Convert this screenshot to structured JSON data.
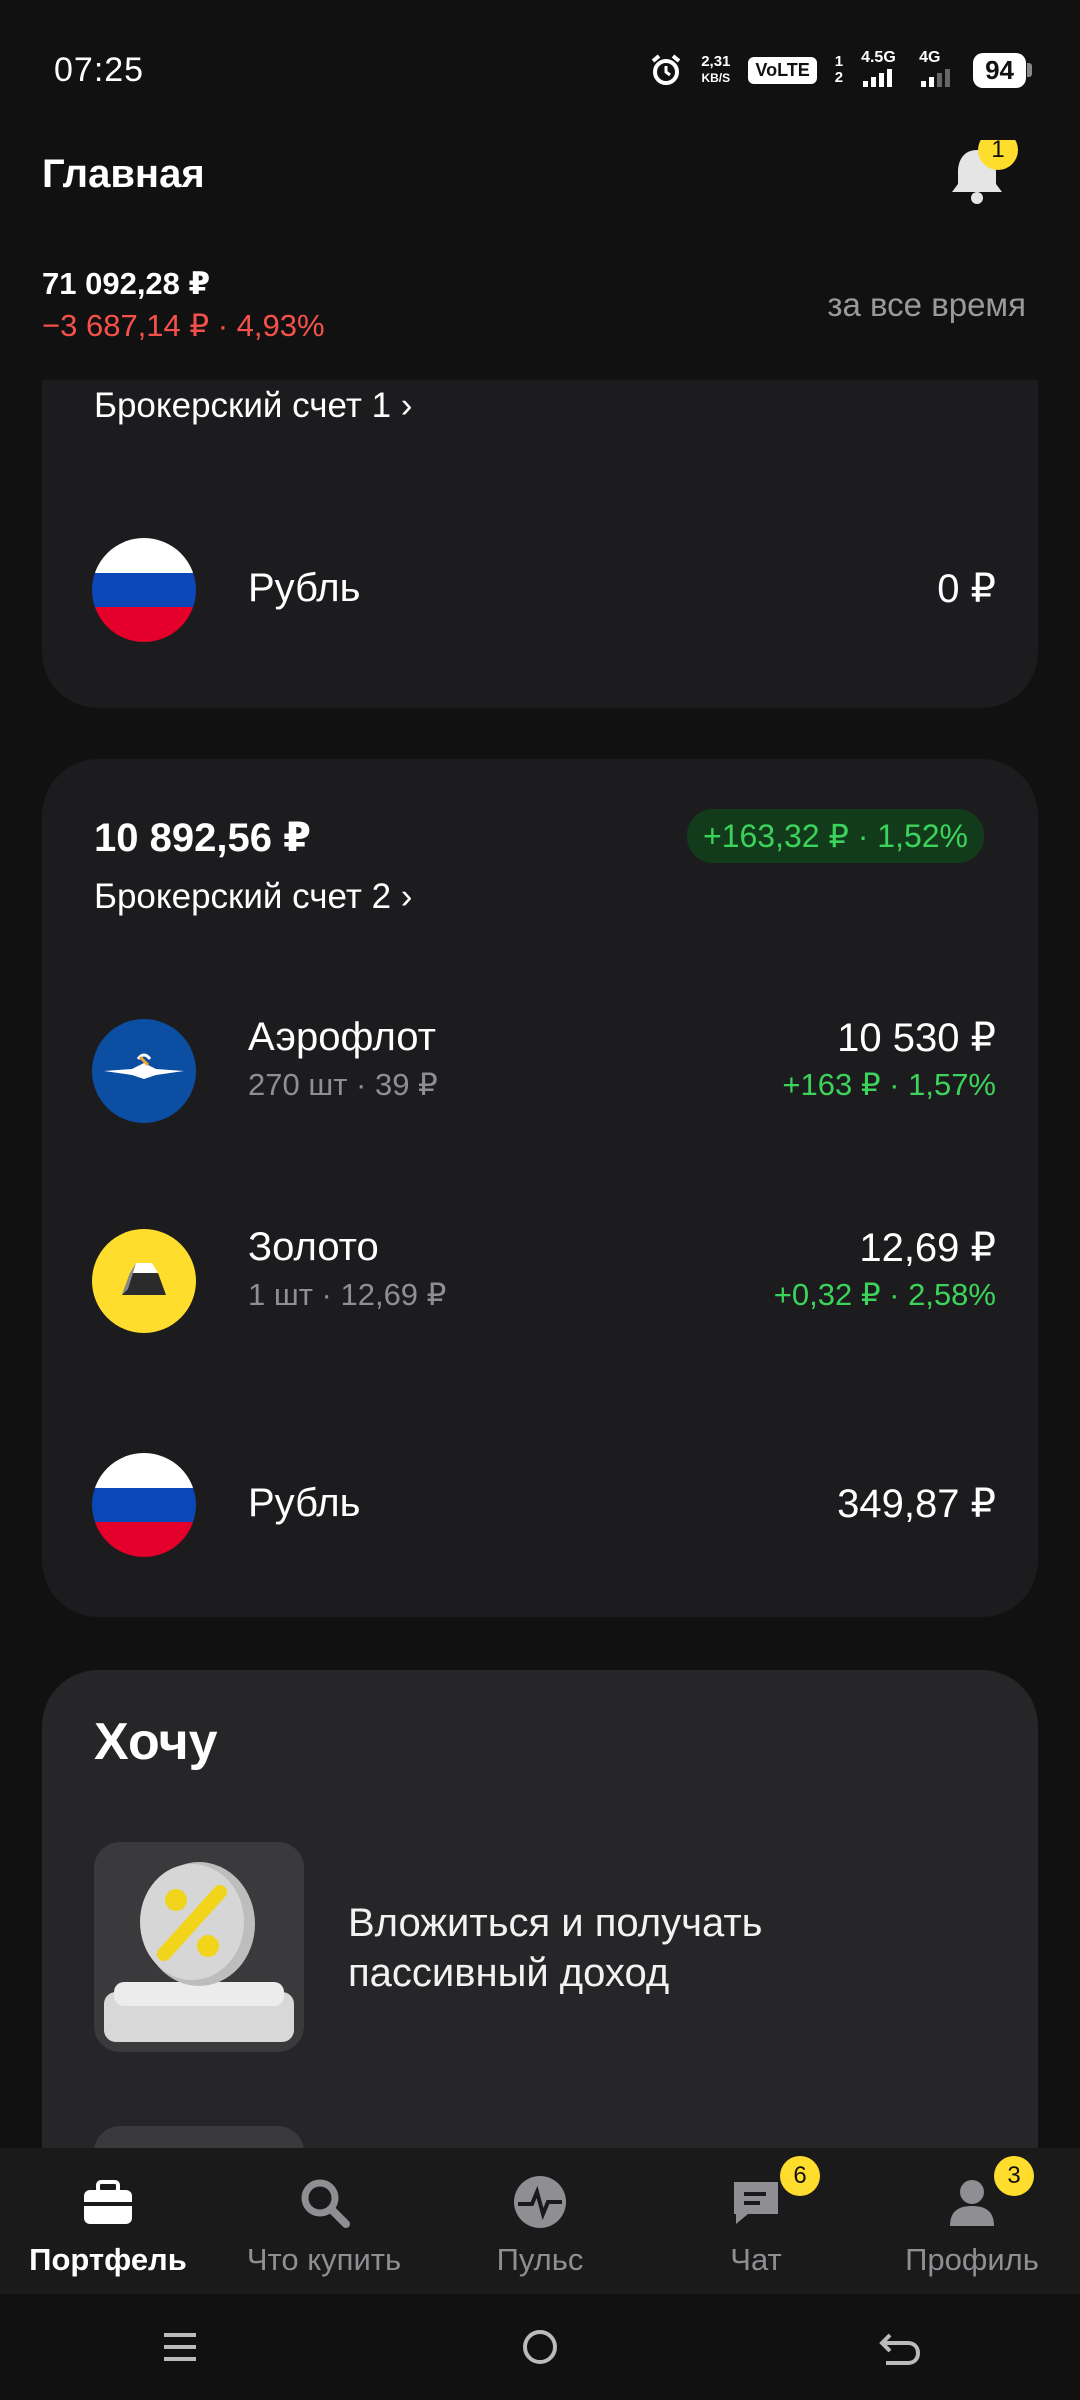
{
  "status_bar": {
    "time": "07:25",
    "net_speed_top": "2,31",
    "net_speed_bottom": "KB/S",
    "volte": "VoLTE",
    "sim1_top": "1",
    "sim1_bottom": "2",
    "net1": "4.5G",
    "net2": "4G",
    "battery": "94"
  },
  "header": {
    "title": "Главная",
    "notifications_count": "1",
    "total_value": "71 092,28  ₽",
    "total_change": "−3 687,14 ₽ · 4,93%",
    "period": "за все время"
  },
  "account1": {
    "link": "Брокерский счет 1 ›",
    "items": [
      {
        "name": "Рубль",
        "value": "0 ₽",
        "icon": "russia-flag-icon"
      }
    ]
  },
  "account2": {
    "value": "10 892,56 ₽",
    "change": "+163,32 ₽ · 1,52%",
    "link": "Брокерский счет 2 ›",
    "items": [
      {
        "name": "Аэрофлот",
        "sub": "270 шт · 39 ₽",
        "value": "10 530 ₽",
        "delta": "+163 ₽ · 1,57%",
        "icon": "aeroflot-logo-icon"
      },
      {
        "name": "Золото",
        "sub": "1 шт · 12,69 ₽",
        "value": "12,69 ₽",
        "delta": "+0,32 ₽ · 2,58%",
        "icon": "gold-bar-icon"
      },
      {
        "name": "Рубль",
        "value": "349,87 ₽",
        "icon": "russia-flag-icon"
      }
    ]
  },
  "want": {
    "title": "Хочу",
    "items": [
      {
        "text_line1": "Вложиться и получать",
        "text_line2": "пассивный доход",
        "icon": "percent-coin-icon"
      }
    ]
  },
  "tabbar": {
    "tabs": [
      {
        "label": "Портфель",
        "icon": "briefcase-icon",
        "active": true
      },
      {
        "label": "Что купить",
        "icon": "search-icon"
      },
      {
        "label": "Пульс",
        "icon": "pulse-icon"
      },
      {
        "label": "Чат",
        "icon": "chat-icon",
        "badge": "6"
      },
      {
        "label": "Профиль",
        "icon": "profile-icon",
        "badge": "3"
      }
    ]
  },
  "colors": {
    "background": "#111111",
    "card": "#1c1c1e",
    "negative": "#f5514a",
    "positive": "#3bd35a",
    "badge": "#ffdd2d"
  }
}
